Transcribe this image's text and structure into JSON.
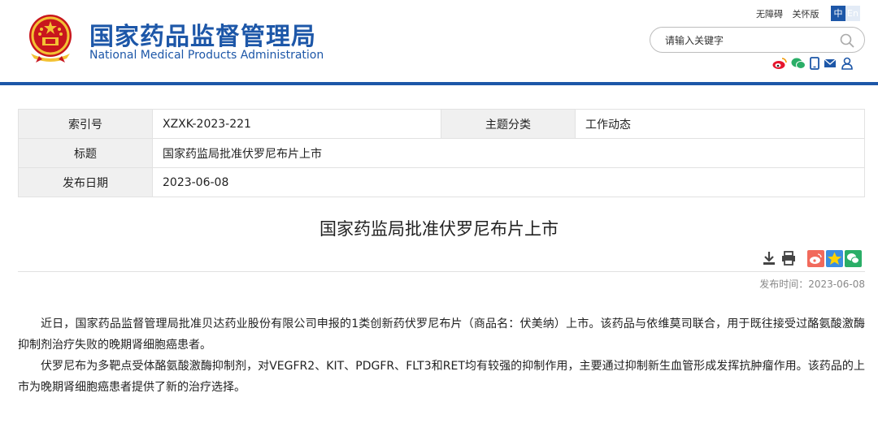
{
  "header": {
    "site_name_cn": "国家药品监督管理局",
    "site_name_en": "National Medical Products Administration",
    "accessibility_link": "无障碍",
    "care_version_link": "关怀版",
    "lang_zh": "中",
    "lang_en": "En",
    "search_placeholder": "请输入关键字",
    "social_icons": [
      "weibo-icon",
      "wechat-icon",
      "mobile-icon",
      "mail-icon",
      "user-icon"
    ],
    "brand_color": "#1d57a8"
  },
  "info_table": {
    "index_label": "索引号",
    "index_value": "XZXK-2023-221",
    "category_label": "主题分类",
    "category_value": "工作动态",
    "title_label": "标题",
    "title_value": "国家药监局批准伏罗尼布片上市",
    "date_label": "发布日期",
    "date_value": "2023-06-08"
  },
  "article": {
    "title": "国家药监局批准伏罗尼布片上市",
    "tool_icons": [
      "download-icon",
      "print-icon"
    ],
    "share_icons": [
      "weibo-share-icon",
      "qzone-share-icon",
      "wechat-share-icon"
    ],
    "publish_time": "发布时间：2023-06-08",
    "paragraphs": [
      "近日，国家药品监督管理局批准贝达药业股份有限公司申报的1类创新药伏罗尼布片（商品名：伏美纳）上市。该药品与依维莫司联合，用于既往接受过酪氨酸激酶抑制剂治疗失败的晚期肾细胞癌患者。",
      "伏罗尼布为多靶点受体酪氨酸激酶抑制剂，对VEGFR2、KIT、PDGFR、FLT3和RET均有较强的抑制作用，主要通过抑制新生血管形成发挥抗肿瘤作用。该药品的上市为晚期肾细胞癌患者提供了新的治疗选择。"
    ]
  }
}
